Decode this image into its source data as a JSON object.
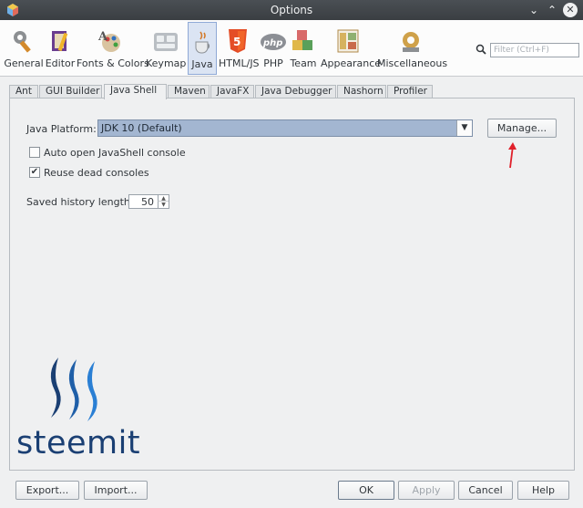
{
  "window": {
    "title": "Options"
  },
  "search": {
    "placeholder": "Filter (Ctrl+F)"
  },
  "categories": [
    {
      "label": "General",
      "icon": "gear-wrench-icon"
    },
    {
      "label": "Editor",
      "icon": "pencil-book-icon"
    },
    {
      "label": "Fonts & Colors",
      "icon": "font-palette-icon"
    },
    {
      "label": "Keymap",
      "icon": "keyboard-icon"
    },
    {
      "label": "Java",
      "icon": "java-cup-icon",
      "selected": true
    },
    {
      "label": "HTML/JS",
      "icon": "html5-icon"
    },
    {
      "label": "PHP",
      "icon": "php-icon"
    },
    {
      "label": "Team",
      "icon": "team-blocks-icon"
    },
    {
      "label": "Appearance",
      "icon": "appearance-icon"
    },
    {
      "label": "Miscellaneous",
      "icon": "misc-gears-icon"
    }
  ],
  "tabs": [
    "Ant",
    "GUI Builder",
    "Java Shell",
    "Maven",
    "JavaFX",
    "Java Debugger",
    "Nashorn",
    "Profiler"
  ],
  "active_tab": "Java Shell",
  "form": {
    "platform_label": "Java Platform:",
    "platform_value": "JDK 10 (Default)",
    "manage_button": "Manage...",
    "auto_open_label": "Auto open JavaShell console",
    "auto_open_checked": false,
    "reuse_label": "Reuse dead consoles",
    "reuse_checked": true,
    "history_label": "Saved history length:",
    "history_value": "50"
  },
  "footer": {
    "export": "Export...",
    "import": "Import...",
    "ok": "OK",
    "apply": "Apply",
    "cancel": "Cancel",
    "help": "Help"
  },
  "watermark": {
    "text": "steemit"
  },
  "colors": {
    "annotation_arrow": "#e0202a",
    "steemit_blue": "#1a3f73",
    "selection": "#a3b6d1"
  }
}
